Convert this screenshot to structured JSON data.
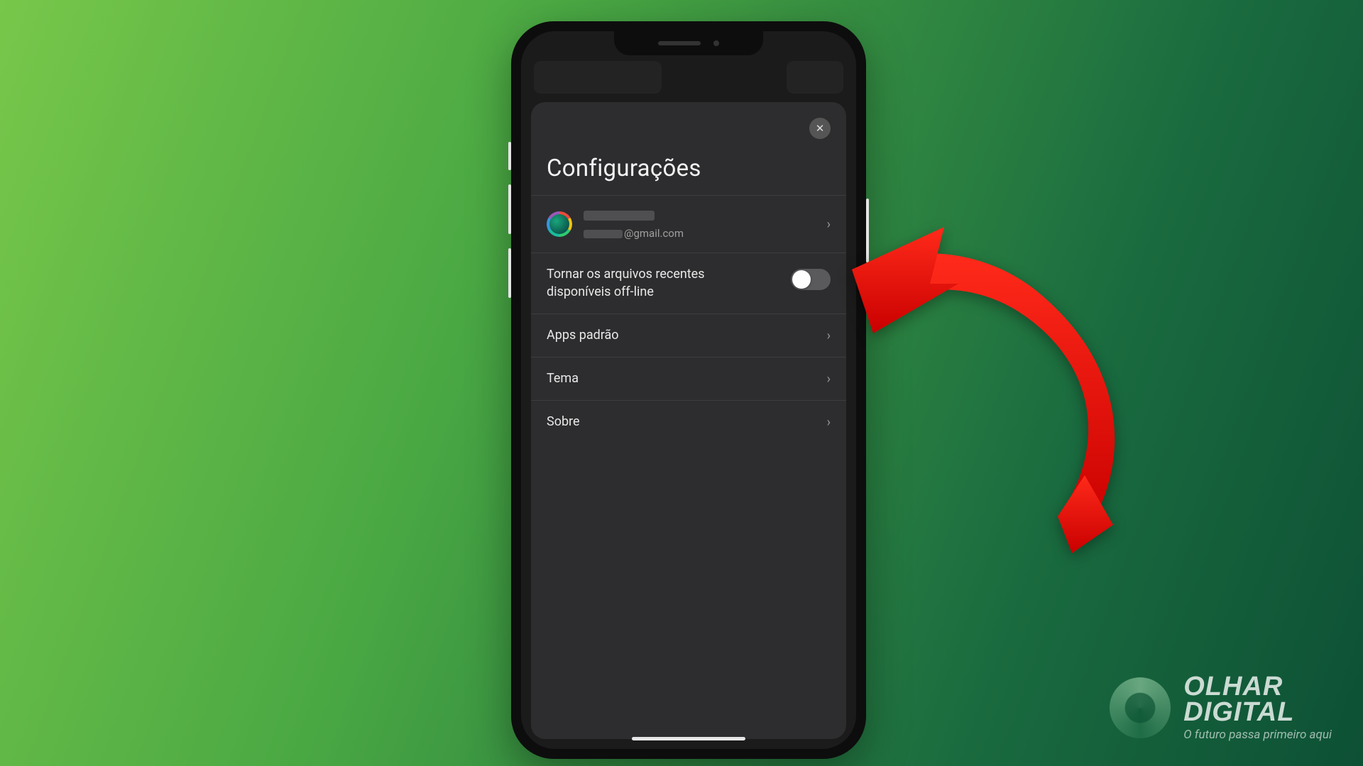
{
  "sheet": {
    "title": "Configurações",
    "close_icon": "✕"
  },
  "account": {
    "email_domain": "@gmail.com"
  },
  "rows": {
    "offline": "Tornar os arquivos recentes disponíveis off-line",
    "default_apps": "Apps padrão",
    "theme": "Tema",
    "about": "Sobre"
  },
  "chevron": "›",
  "watermark": {
    "brand_line1": "OLHAR",
    "brand_line2": "DIGITAL",
    "tagline": "O futuro passa primeiro aqui"
  }
}
